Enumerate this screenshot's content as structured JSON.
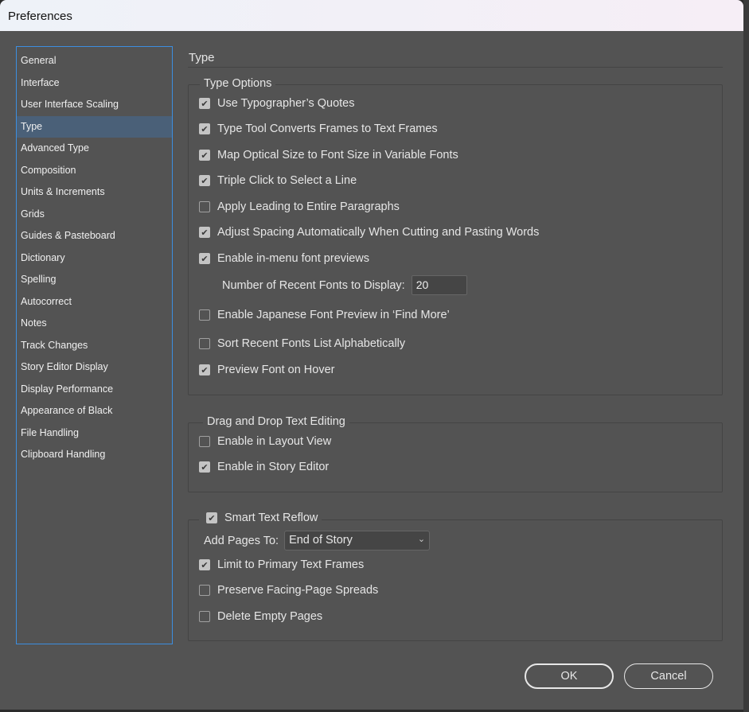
{
  "window": {
    "title": "Preferences"
  },
  "sidebar": {
    "items": [
      "General",
      "Interface",
      "User Interface Scaling",
      "Type",
      "Advanced Type",
      "Composition",
      "Units & Increments",
      "Grids",
      "Guides & Pasteboard",
      "Dictionary",
      "Spelling",
      "Autocorrect",
      "Notes",
      "Track Changes",
      "Story Editor Display",
      "Display Performance",
      "Appearance of Black",
      "File Handling",
      "Clipboard Handling"
    ],
    "selected": "Type"
  },
  "main": {
    "title": "Type",
    "type_options": {
      "legend": "Type Options",
      "options": [
        {
          "label": "Use Typographer’s Quotes",
          "checked": true
        },
        {
          "label": "Type Tool Converts Frames to Text Frames",
          "checked": true
        },
        {
          "label": "Map Optical Size to Font Size in Variable Fonts",
          "checked": true
        },
        {
          "label": "Triple Click to Select a Line",
          "checked": true
        },
        {
          "label": "Apply Leading to Entire Paragraphs",
          "checked": false
        },
        {
          "label": "Adjust Spacing Automatically When Cutting and Pasting Words",
          "checked": true
        },
        {
          "label": "Enable in-menu font previews",
          "checked": true
        }
      ],
      "recent_fonts_label": "Number of Recent Fonts to Display:",
      "recent_fonts_value": "20",
      "options2": [
        {
          "label": "Enable Japanese Font Preview in ‘Find More’",
          "checked": false
        },
        {
          "label": "Sort Recent Fonts List Alphabetically",
          "checked": false
        },
        {
          "label": "Preview Font on Hover",
          "checked": true
        }
      ]
    },
    "drag_drop": {
      "legend": "Drag and Drop Text Editing",
      "options": [
        {
          "label": "Enable in Layout View",
          "checked": false
        },
        {
          "label": "Enable in Story Editor",
          "checked": true
        }
      ]
    },
    "smart_reflow": {
      "legend": "Smart Text Reflow",
      "checked": true,
      "add_pages_label": "Add Pages To:",
      "add_pages_value": "End of Story",
      "options": [
        {
          "label": "Limit to Primary Text Frames",
          "checked": true
        },
        {
          "label": "Preserve Facing-Page Spreads",
          "checked": false
        },
        {
          "label": "Delete Empty Pages",
          "checked": false
        }
      ]
    }
  },
  "buttons": {
    "ok": "OK",
    "cancel": "Cancel"
  }
}
